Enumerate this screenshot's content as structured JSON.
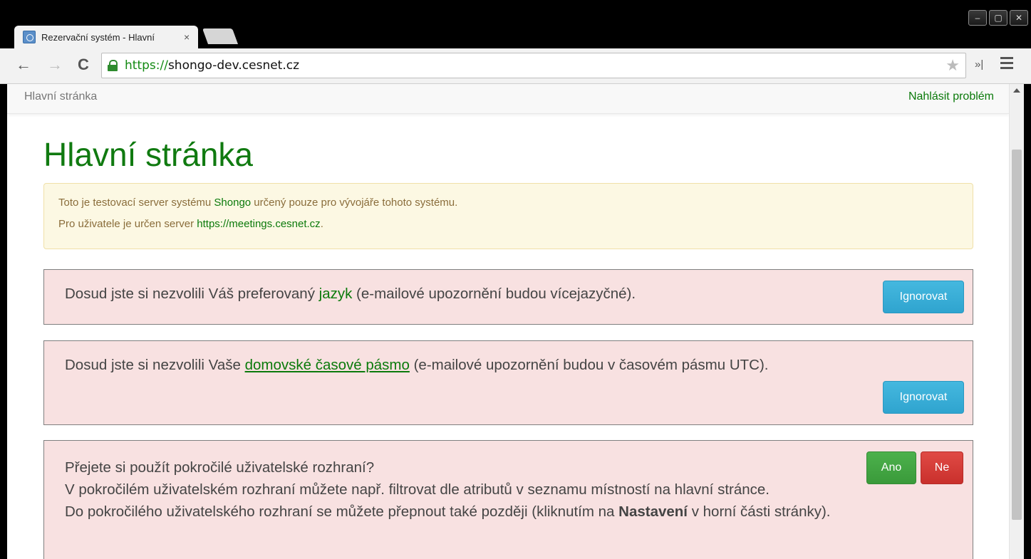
{
  "browser": {
    "tab_title": "Rezervační systém - Hlavní",
    "tab_close": "×",
    "url_scheme": "https://",
    "url_host": "shongo-dev.cesnet.cz",
    "ext_label": "»|",
    "window_buttons": [
      "–",
      "▢",
      "✕"
    ]
  },
  "navbar": {
    "home": "Hlavní stránka",
    "report": "Nahlásit problém"
  },
  "page": {
    "title": "Hlavní stránka",
    "warning": {
      "line1_pre": "Toto je testovací server systému ",
      "line1_link": "Shongo",
      "line1_post": " určený pouze pro vývojáře tohoto systému.",
      "line2_pre": "Pro uživatele je určen server ",
      "line2_link": "https://meetings.cesnet.cz",
      "line2_post": "."
    },
    "language_alert": {
      "pre": "Dosud jste si nezvolili Váš preferovaný ",
      "link": "jazyk",
      "post": " (e-mailové upozornění budou vícejazyčné).",
      "button": "Ignorovat"
    },
    "timezone_alert": {
      "pre": "Dosud jste si nezvolili Vaše ",
      "link": "domovské časové pásmo",
      "post": " (e-mailové upozornění budou v časovém pásmu UTC).",
      "button": "Ignorovat"
    },
    "advanced_alert": {
      "question": "Přejete si použít pokročilé uživatelské rozhraní?",
      "line2": "V pokročilém uživatelském rozhraní můžete např. filtrovat dle atributů v seznamu místností na hlavní stránce.",
      "line3_pre": "Do pokročilého uživatelského rozhraní se můžete přepnout také později (kliknutím na ",
      "line3_bold": "Nastavení",
      "line3_post": " v horní části stránky).",
      "yes": "Ano",
      "no": "Ne"
    }
  },
  "colors": {
    "brand_green": "#107a10",
    "info": "#31a8d4",
    "success": "#40a340",
    "danger": "#d43f3a"
  }
}
